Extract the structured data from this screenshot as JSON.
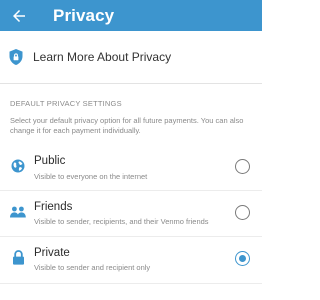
{
  "colors": {
    "brand_blue": "#3d95ce",
    "text_primary": "#2b2b2b",
    "text_secondary": "#8a8a8a"
  },
  "header": {
    "title": "Privacy",
    "back_icon": "arrow-left-icon"
  },
  "learn_more": {
    "icon": "shield-lock-icon",
    "label": "Learn More About Privacy"
  },
  "settings": {
    "section_header": "DEFAULT PRIVACY SETTINGS",
    "description": "Select your default privacy option for all future payments. You can also change it for each payment individually.",
    "selected": "Private",
    "options": [
      {
        "icon": "globe-icon",
        "title": "Public",
        "description": "Visible to everyone on the internet",
        "selected": false
      },
      {
        "icon": "friends-icon",
        "title": "Friends",
        "description": "Visible to sender, recipients, and their Venmo friends",
        "selected": false
      },
      {
        "icon": "lock-icon",
        "title": "Private",
        "description": "Visible to sender and recipient only",
        "selected": true
      }
    ]
  }
}
